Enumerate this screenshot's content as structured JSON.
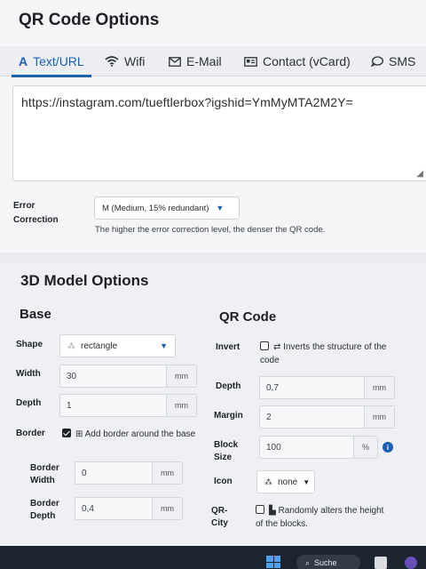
{
  "qr_options": {
    "title": "QR Code Options",
    "tabs": [
      {
        "label": "Text/URL",
        "icon": "text-icon",
        "active": true
      },
      {
        "label": "Wifi",
        "icon": "wifi-icon",
        "active": false
      },
      {
        "label": "E-Mail",
        "icon": "mail-icon",
        "active": false
      },
      {
        "label": "Contact (vCard)",
        "icon": "contact-card-icon",
        "active": false
      },
      {
        "label": "SMS",
        "icon": "chat-bubble-icon",
        "active": false
      }
    ],
    "text_value": "https://instagram.com/tueftlerbox?igshid=YmMyMTA2M2Y=",
    "error_correction": {
      "label_line1": "Error",
      "label_line2": "Correction",
      "selected": "M (Medium, 15% redundant)",
      "help": "The higher the error correction level, the denser the QR code."
    }
  },
  "model_options": {
    "title": "3D Model Options",
    "base": {
      "heading": "Base",
      "shape": {
        "label": "Shape",
        "value": "rectangle"
      },
      "width": {
        "label": "Width",
        "value": "30",
        "unit": "mm"
      },
      "depth": {
        "label": "Depth",
        "value": "1",
        "unit": "mm"
      },
      "border": {
        "label": "Border",
        "checked": true,
        "text": "Add border around the base"
      },
      "border_width": {
        "label_line1": "Border",
        "label_line2": "Width",
        "value": "0",
        "unit": "mm"
      },
      "border_depth": {
        "label_line1": "Border",
        "label_line2": "Depth",
        "value": "0,4",
        "unit": "mm"
      }
    },
    "qr_code": {
      "heading": "QR Code",
      "invert": {
        "label": "Invert",
        "checked": false,
        "text_line1": "Inverts the structure of the",
        "text_line2": "code"
      },
      "depth": {
        "label": "Depth",
        "value": "0,7",
        "unit": "mm"
      },
      "margin": {
        "label": "Margin",
        "value": "2",
        "unit": "mm"
      },
      "block_size": {
        "label_line1": "Block",
        "label_line2": "Size",
        "value": "100",
        "unit": "%"
      },
      "icon": {
        "label": "Icon",
        "value": "none"
      },
      "qr_city": {
        "label_line1": "QR-",
        "label_line2": "City",
        "checked": false,
        "text_line1": "Randomly alters the height",
        "text_line2": "of the blocks."
      }
    }
  },
  "taskbar": {
    "search_label": "Suche"
  },
  "colors": {
    "accent": "#1a5fb4",
    "card_bg": "#f4f5f7",
    "taskbar": "#1c2430"
  }
}
